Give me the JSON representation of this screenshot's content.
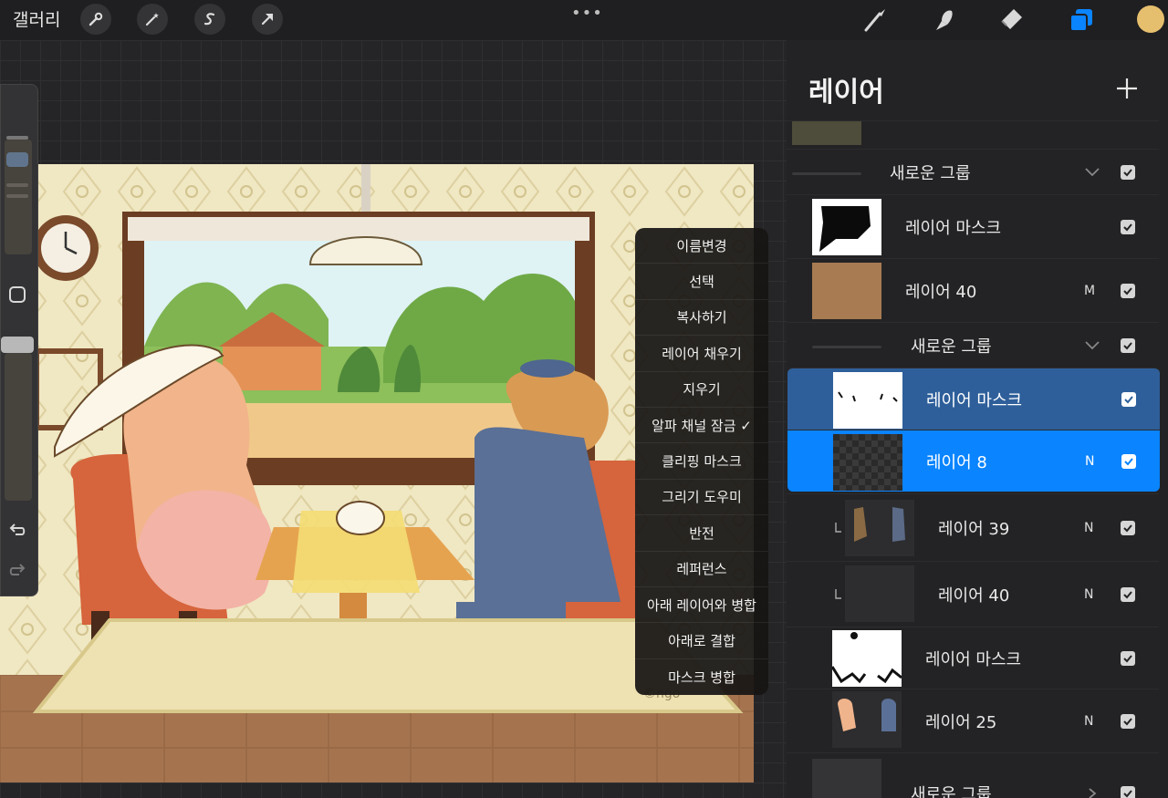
{
  "topbar": {
    "gallery_label": "갤러리",
    "left_tools": [
      "wrench-icon",
      "magic-wand-icon",
      "selection-s-icon",
      "arrow-transform-icon"
    ],
    "more_label": "•••",
    "right_tools": [
      "brush-icon",
      "smudge-icon",
      "eraser-icon",
      "layers-icon"
    ],
    "color": "#e6bf6e",
    "accent": "#0a84ff"
  },
  "sidebar": {
    "undo_icon": "undo-icon",
    "redo_icon": "redo-icon",
    "modifier_icon": "square-modifier-icon"
  },
  "context_menu": {
    "items": [
      "이름변경",
      "선택",
      "복사하기",
      "레이어 채우기",
      "지우기",
      "알파 채널 잠금 ✓",
      "클리핑 마스크",
      "그리기 도우미",
      "반전",
      "레퍼런스",
      "아래 레이어와 병합",
      "아래로 결합",
      "마스크 병합"
    ]
  },
  "layers_panel": {
    "title": "레이어",
    "add_icon": "plus-icon",
    "rows": [
      {
        "name": "",
        "kind": "partial-thumb"
      },
      {
        "name": "새로운 그룹",
        "kind": "group",
        "expanded": true
      },
      {
        "name": "레이어 마스크",
        "kind": "mask",
        "visible": true
      },
      {
        "name": "레이어 40",
        "blend": "M",
        "kind": "layer",
        "visible": true
      },
      {
        "name": "새로운 그룹",
        "kind": "group",
        "expanded": true
      },
      {
        "name": "레이어 마스크",
        "kind": "mask",
        "visible": true,
        "state": "selected-secondary"
      },
      {
        "name": "레이어 8",
        "blend": "N",
        "kind": "layer",
        "visible": true,
        "state": "selected"
      },
      {
        "name": "레이어 39",
        "blend": "N",
        "kind": "clipped",
        "visible": true
      },
      {
        "name": "레이어 40",
        "blend": "N",
        "kind": "clipped",
        "visible": true
      },
      {
        "name": "레이어 마스크",
        "kind": "mask",
        "visible": true
      },
      {
        "name": "레이어 25",
        "blend": "N",
        "kind": "layer",
        "visible": true
      },
      {
        "name": "새로운 그룹",
        "kind": "group",
        "expanded": false,
        "visible": true
      }
    ]
  }
}
